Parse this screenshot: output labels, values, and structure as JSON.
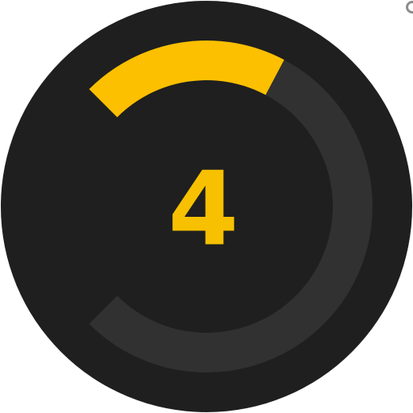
{
  "gauge": {
    "value_text": "4",
    "fill_fraction": 0.27,
    "colors": {
      "background": "#1f1f1f",
      "track": "#313131",
      "fill": "#fcc000",
      "text": "#f7c101"
    }
  }
}
